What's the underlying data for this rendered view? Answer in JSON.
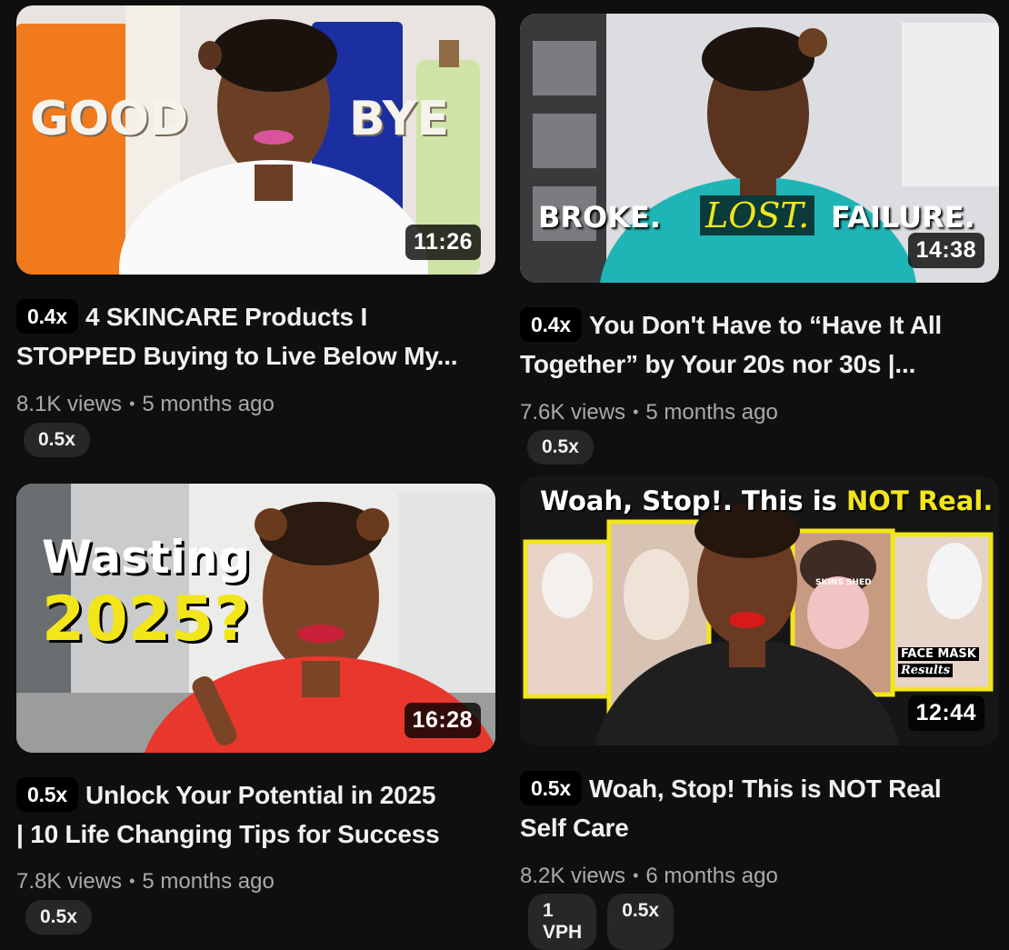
{
  "videos": [
    {
      "thumbnail": {
        "overlay_left": "GOOD",
        "overlay_right": "BYE"
      },
      "duration": "11:26",
      "speed": "0.4x",
      "title_lines": [
        "4 SKINCARE Products I",
        "STOPPED Buying to Live Below My..."
      ],
      "views": "8.1K views",
      "age": "5 months ago",
      "chips": [
        "0.5x"
      ]
    },
    {
      "thumbnail": {
        "overlay_words": [
          "BROKE.",
          "LOST.",
          "FAILURE."
        ]
      },
      "duration": "14:38",
      "speed": "0.4x",
      "title_lines": [
        "You Don't Have to “Have It All",
        "Together” by Your 20s nor 30s |..."
      ],
      "views": "7.6K views",
      "age": "5 months ago",
      "chips": [
        "0.5x"
      ]
    },
    {
      "thumbnail": {
        "overlay_top": "Wasting",
        "overlay_bottom": "2025?"
      },
      "duration": "16:28",
      "speed": "0.5x",
      "title_lines": [
        "Unlock Your Potential in 2025",
        "| 10 Life Changing Tips for Success"
      ],
      "views": "7.8K views",
      "age": "5 months ago",
      "chips": [
        "0.5x"
      ]
    },
    {
      "thumbnail": {
        "headline_white": "Woah, Stop!. This is",
        "headline_yellow": "NOT Real.",
        "label_mask": "FACE MASK",
        "label_results": "Results",
        "label_small": "SKINS SHED"
      },
      "duration": "12:44",
      "speed": "0.5x",
      "title_lines": [
        "Woah, Stop! This is NOT Real",
        "Self Care"
      ],
      "views": "8.2K views",
      "age": "6 months ago",
      "chips": [
        "1 VPH",
        "0.5x"
      ]
    }
  ],
  "colors": {
    "background": "#0f0f0f",
    "chip_bg": "#272727",
    "meta_text": "#aaaaaa",
    "thumb_yellow": "#f2e61a"
  }
}
